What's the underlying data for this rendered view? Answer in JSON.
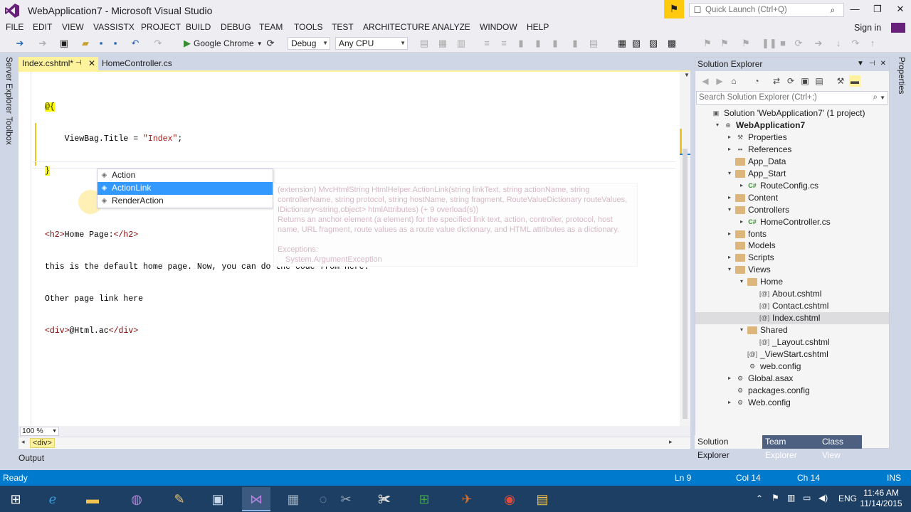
{
  "window": {
    "title": "WebApplication7 - Microsoft Visual Studio",
    "quick_launch_placeholder": "Quick Launch (Ctrl+Q)"
  },
  "menu": [
    "FILE",
    "EDIT",
    "VIEW",
    "VASSISTX",
    "PROJECT",
    "BUILD",
    "DEBUG",
    "TEAM",
    "TOOLS",
    "TEST",
    "ARCHITECTURE",
    "ANALYZE",
    "WINDOW",
    "HELP"
  ],
  "signin": "Sign in",
  "toolbar": {
    "run_target": "Google Chrome",
    "configuration": "Debug",
    "platform": "Any CPU"
  },
  "side_tabs": {
    "left": [
      "Server Explorer",
      "Toolbox"
    ],
    "right": [
      "Properties"
    ]
  },
  "doc_tabs": [
    {
      "label": "Index.cshtml*",
      "active": true
    },
    {
      "label": "HomeController.cs",
      "active": false
    }
  ],
  "code": {
    "line1": "@{",
    "line2_pre": "    ViewBag.Title = ",
    "line2_str": "\"Index\"",
    "line2_post": ";",
    "line3": "}",
    "line5_open": "<h2>",
    "line5_text": "Home Page:",
    "line5_close": "</h2>",
    "line6": "this is the default home page. Now, you can do the code from here.",
    "line7": "Other page link here",
    "line8_open": "<div>",
    "line8_code": "@Html.ac",
    "line8_close": "</div>"
  },
  "completion": {
    "items": [
      "Action",
      "ActionLink",
      "RenderAction"
    ],
    "selected": "ActionLink"
  },
  "tooltip": {
    "signature": "(extension) MvcHtmlString HtmlHelper.ActionLink(string linkText, string actionName, string controllerName, string protocol, string hostName, string fragment, RouteValueDictionary routeValues, IDictionary<string,object> htmlAttributes)  (+ 9 overload(s))",
    "description": "Returns an anchor element (a element) for the specified link text, action, controller, protocol, host name, URL fragment, route values as a route value dictionary, and HTML attributes as a dictionary.",
    "exceptions_label": "Exceptions:",
    "exception": "System.ArgumentException"
  },
  "editor_footer": {
    "zoom": "100 %",
    "breadcrumb": "<div>"
  },
  "output_tab": "Output",
  "solution_explorer": {
    "title": "Solution Explorer",
    "search_placeholder": "Search Solution Explorer (Ctrl+;)",
    "tree": [
      {
        "label": "Solution 'WebApplication7' (1 project)",
        "depth": 0,
        "expander": "",
        "icon": "solution"
      },
      {
        "label": "WebApplication7",
        "depth": 1,
        "expander": "▾",
        "icon": "project"
      },
      {
        "label": "Properties",
        "depth": 2,
        "expander": "▸",
        "icon": "wrench"
      },
      {
        "label": "References",
        "depth": 2,
        "expander": "▸",
        "icon": "references"
      },
      {
        "label": "App_Data",
        "depth": 2,
        "expander": "",
        "icon": "folder"
      },
      {
        "label": "App_Start",
        "depth": 2,
        "expander": "▾",
        "icon": "folder"
      },
      {
        "label": "RouteConfig.cs",
        "depth": 3,
        "expander": "▸",
        "icon": "cs"
      },
      {
        "label": "Content",
        "depth": 2,
        "expander": "▸",
        "icon": "folder"
      },
      {
        "label": "Controllers",
        "depth": 2,
        "expander": "▾",
        "icon": "folder"
      },
      {
        "label": "HomeController.cs",
        "depth": 3,
        "expander": "▸",
        "icon": "cs"
      },
      {
        "label": "fonts",
        "depth": 2,
        "expander": "▸",
        "icon": "folder"
      },
      {
        "label": "Models",
        "depth": 2,
        "expander": "",
        "icon": "folder"
      },
      {
        "label": "Scripts",
        "depth": 2,
        "expander": "▸",
        "icon": "folder"
      },
      {
        "label": "Views",
        "depth": 2,
        "expander": "▾",
        "icon": "folder"
      },
      {
        "label": "Home",
        "depth": 3,
        "expander": "▾",
        "icon": "folder"
      },
      {
        "label": "About.cshtml",
        "depth": 4,
        "expander": "",
        "icon": "cshtml"
      },
      {
        "label": "Contact.cshtml",
        "depth": 4,
        "expander": "",
        "icon": "cshtml"
      },
      {
        "label": "Index.cshtml",
        "depth": 4,
        "expander": "",
        "icon": "cshtml",
        "selected": true
      },
      {
        "label": "Shared",
        "depth": 3,
        "expander": "▾",
        "icon": "folder"
      },
      {
        "label": "_Layout.cshtml",
        "depth": 4,
        "expander": "",
        "icon": "cshtml"
      },
      {
        "label": "_ViewStart.cshtml",
        "depth": 3,
        "expander": "",
        "icon": "cshtml"
      },
      {
        "label": "web.config",
        "depth": 3,
        "expander": "",
        "icon": "config"
      },
      {
        "label": "Global.asax",
        "depth": 2,
        "expander": "▸",
        "icon": "config"
      },
      {
        "label": "packages.config",
        "depth": 2,
        "expander": "",
        "icon": "config"
      },
      {
        "label": "Web.config",
        "depth": 2,
        "expander": "▸",
        "icon": "config"
      }
    ],
    "tabs": [
      "Solution Explorer",
      "Team Explorer",
      "Class View"
    ]
  },
  "status": {
    "text": "Ready",
    "ln": "Ln 9",
    "col": "Col 14",
    "ch": "Ch 14",
    "mode": "INS"
  },
  "taskbar": {
    "language": "ENG",
    "time": "11:46 AM",
    "date": "11/14/2015"
  }
}
